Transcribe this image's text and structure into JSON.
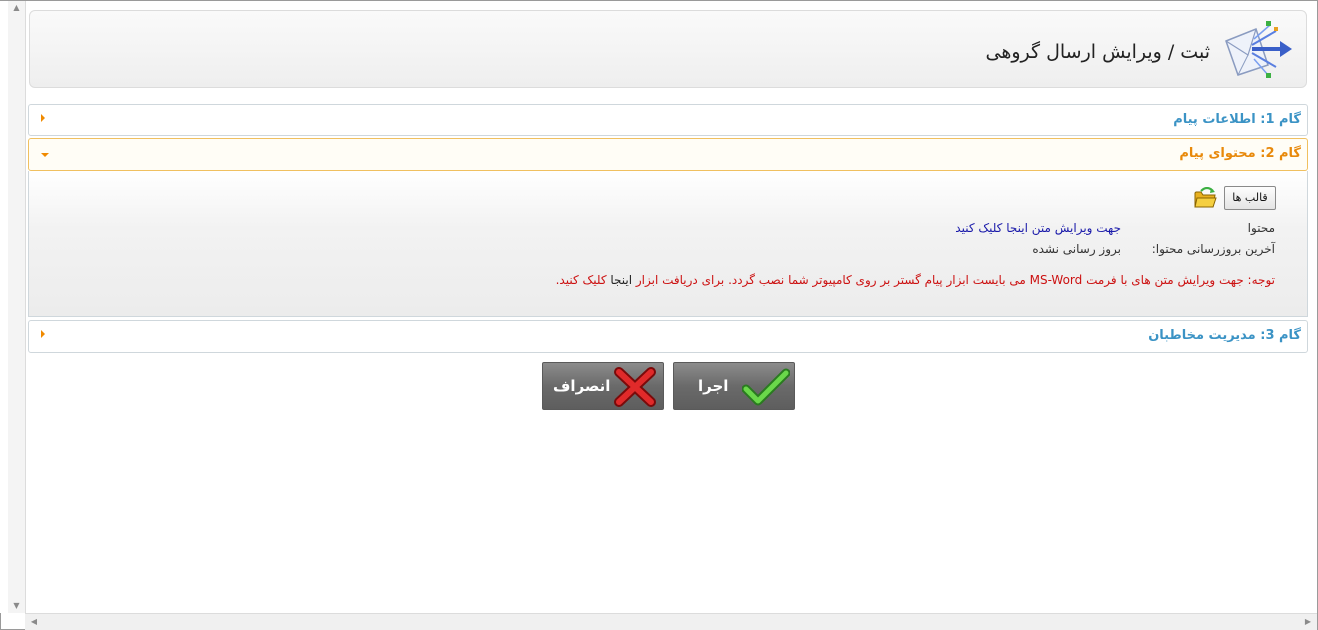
{
  "header": {
    "title": "ثبت / ویرایش ارسال گروهی",
    "icon": "bulk-send-mail-icon"
  },
  "steps": [
    {
      "label": "گام 1: اطلاعات پیام",
      "expanded": false
    },
    {
      "label": "گام 2: محتوای پیام",
      "expanded": true
    },
    {
      "label": "گام 3: مدیریت مخاطبان",
      "expanded": false
    }
  ],
  "content": {
    "templates_button": "قالب ها",
    "content_label": "محتوا",
    "content_link": "جهت ویرایش متن اینجا کلیک کنید",
    "last_update_label": "آخرین بروزرسانی محتوا:",
    "last_update_value": "بروز رسانی نشده",
    "note_prefix": "توجه: جهت ویرایش متن های با فرمت MS-Word می بایست ابزار پیام گستر بر روی کامپیوتر شما نصب گردد. برای دریافت ابزار ",
    "note_link": "اینجا",
    "note_suffix": " کلیک کنید."
  },
  "actions": {
    "run": "اجرا",
    "cancel": "انصراف"
  },
  "colors": {
    "step_label": "#3b93c5",
    "active_step": "#e8890b",
    "note": "#cc1111",
    "link": "#1a1aaa"
  }
}
